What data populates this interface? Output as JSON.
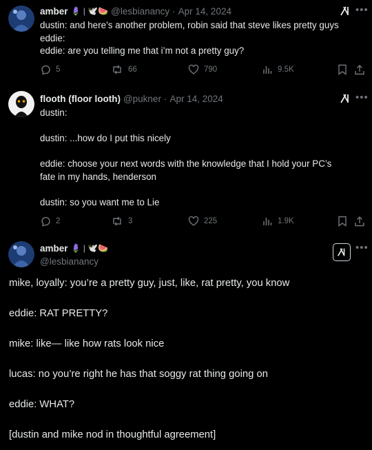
{
  "tweets": [
    {
      "name": "amber",
      "badges": "🪻 | 🕊️🍉",
      "handle": "@lesbianancy",
      "date": "Apr 14, 2024",
      "separator": "·",
      "lines": [
        "dustin: and here’s another problem, robin said that steve likes pretty guys",
        "eddie:",
        "eddie: are you telling me that i’m not a pretty guy?"
      ],
      "stats": {
        "replies": "5",
        "reposts": "66",
        "likes": "790",
        "views": "9.5K"
      }
    },
    {
      "name": "flooth (floor looth)",
      "handle": "@pukner",
      "date": "Apr 14, 2024",
      "separator": "·",
      "lines": [
        "dustin:",
        "dustin: ...how do I put this nicely",
        "eddie: choose your next words with the knowledge that I hold your PC’s",
        "fate in my hands, henderson",
        "dustin: so you want me to Lie"
      ],
      "stats": {
        "replies": "2",
        "reposts": "3",
        "likes": "225",
        "views": "1.9K"
      }
    },
    {
      "name": "amber",
      "badges": "🪻 | 🕊️🍉",
      "handle": "@lesbianancy",
      "lines": [
        "mike, loyally: you’re a pretty guy, just, like, rat pretty, you know",
        "eddie: RAT PRETTY?",
        "mike: like— like how rats look nice",
        "lucas: no you’re right he has that soggy rat thing going on",
        "eddie: WHAT?",
        "[dustin and mike nod in thoughtful agreement]"
      ]
    }
  ],
  "icons": {
    "more": "•••",
    "accent": "#1d9bf0",
    "muted": "#71767b"
  }
}
